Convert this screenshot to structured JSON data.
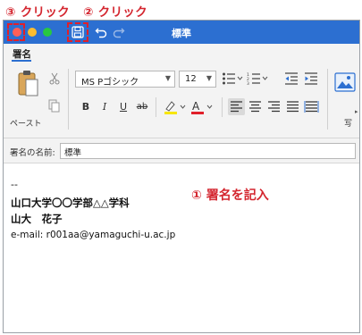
{
  "annotations": {
    "step3": "③ クリック",
    "step2": "② クリック",
    "step1": "① 署名を記入"
  },
  "window": {
    "title": "標準"
  },
  "ribbon": {
    "tab_active": "署名",
    "paste_label": "ペースト",
    "font_name": "MS Pゴシック",
    "font_size": "12",
    "picture_label": "写",
    "bold": "B",
    "italic": "I",
    "underline": "U",
    "strike": "ab"
  },
  "signature_name": {
    "label": "署名の名前:",
    "value": "標準"
  },
  "body": {
    "lines": [
      "--",
      "山口大学〇〇学部△△学科",
      "山大　花子",
      "e-mail: r001aa@yamaguchi-u.ac.jp"
    ]
  },
  "colors": {
    "titlebar": "#2c6fd1",
    "annotation_red": "#d4262f",
    "close": "#ff5f57",
    "minimize": "#febc2e",
    "zoom": "#28c840"
  }
}
